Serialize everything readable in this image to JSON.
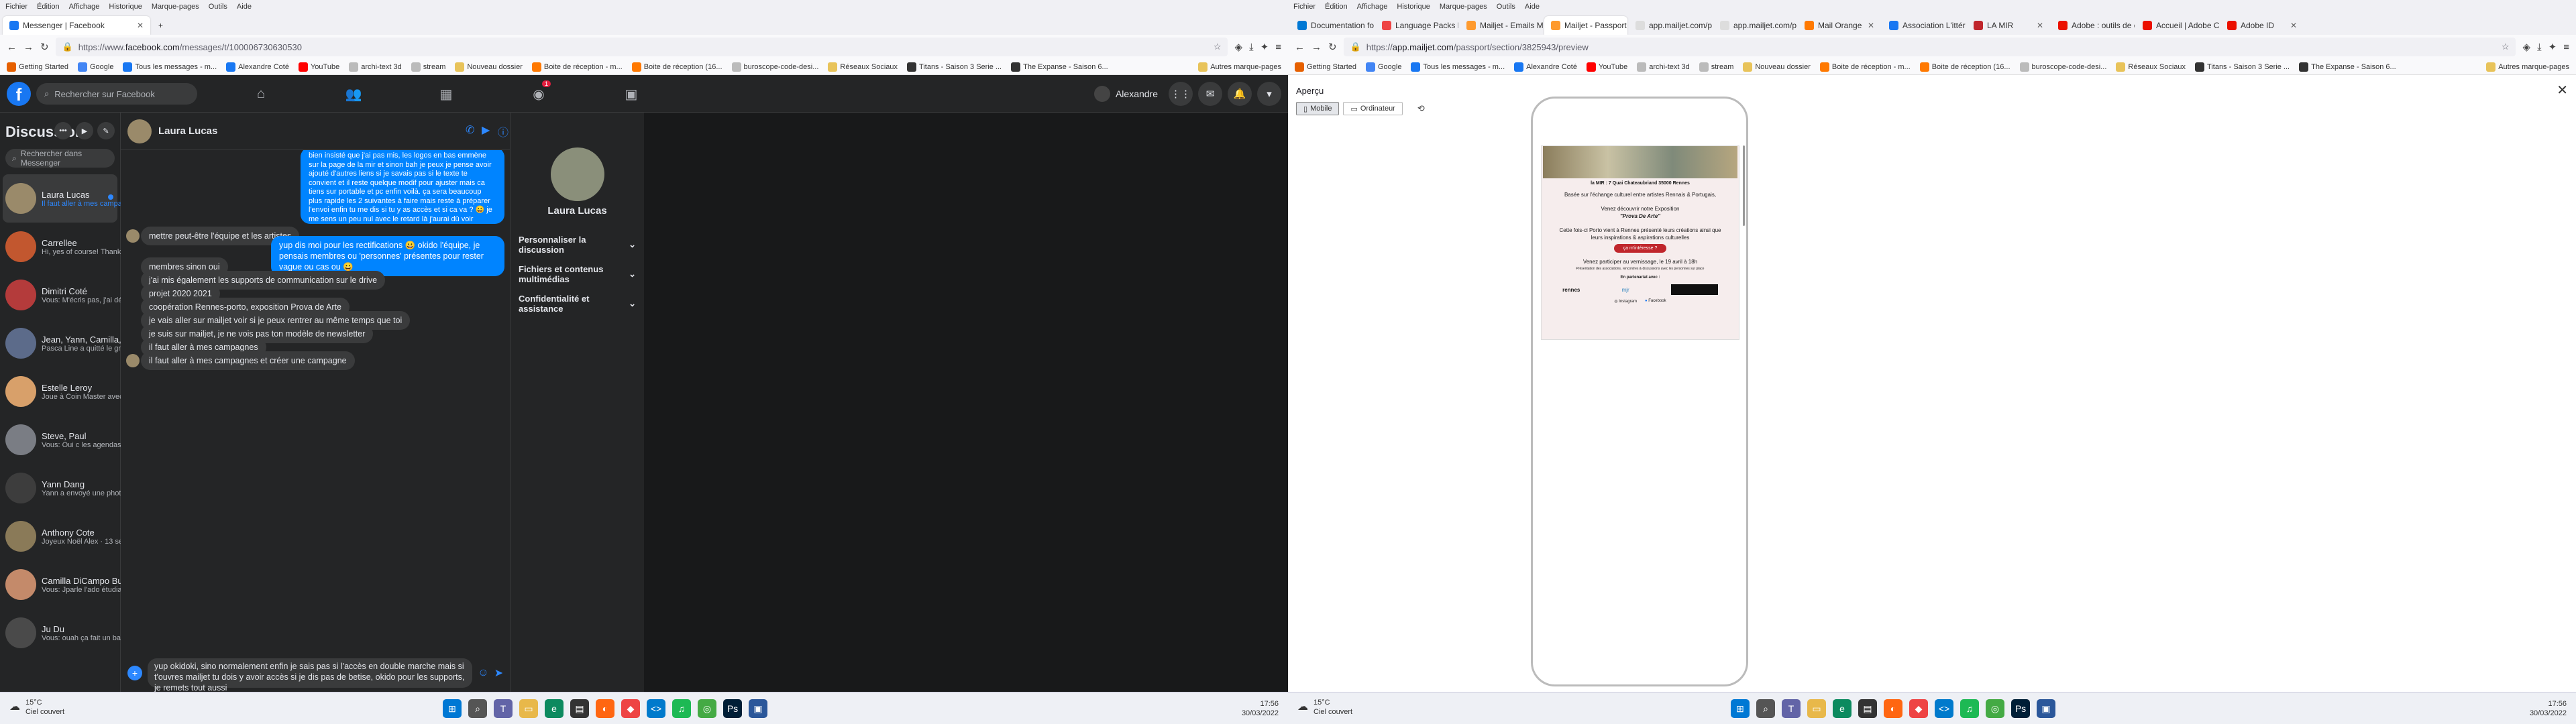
{
  "left": {
    "menu": [
      "Fichier",
      "Édition",
      "Affichage",
      "Historique",
      "Marque-pages",
      "Outils",
      "Aide"
    ],
    "tab": {
      "label": "Messenger | Facebook"
    },
    "url": {
      "prefix": "https://www.",
      "domain": "facebook.com",
      "path": "/messages/t/100006730630530"
    },
    "bookmarks": [
      "Getting Started",
      "Google",
      "Tous les messages - m...",
      "Alexandre Coté",
      "YouTube",
      "archi-text 3d",
      "stream",
      "Nouveau dossier",
      "Boite de réception - m...",
      "Boite de réception (16...",
      "buroscope-code-desi...",
      "Réseaux Sociaux",
      "Titans - Saison 3 Serie ...",
      "The Expanse - Saison 6...",
      "Autres marque-pages"
    ],
    "fb": {
      "search_placeholder": "Rechercher sur Facebook",
      "nav_badge": "1",
      "user": "Alexandre",
      "sidebar_title": "Discussions",
      "sidebar_search": "Rechercher dans Messenger",
      "conversations": [
        {
          "name": "Laura Lucas",
          "preview": "Il faut aller à mes campagnes ... · 1 min",
          "color": "#9a8a6a"
        },
        {
          "name": "Carrellee",
          "preview": "Hi, yes of course! Thanks for askin... · 6 min",
          "color": "#c2572f"
        },
        {
          "name": "Dimitri Coté",
          "preview": "Vous: M'écris pas, j'ai déjà blo... · 1 sem",
          "color": "#b43b3b"
        },
        {
          "name": "Jean, Yann, Camilla, Stephanie, M...",
          "preview": "Pasca Line a quitté le groupe. · 2 sem",
          "color": "#5c6b8a"
        },
        {
          "name": "Estelle Leroy",
          "preview": "Joue à Coin Master avec moi ! ... · 9 sem",
          "color": "#d8a06a"
        },
        {
          "name": "Steve, Paul",
          "preview": "Vous: Oui c les agendas qui... · 11 sem",
          "color": "#7a7d84"
        },
        {
          "name": "Yann Dang",
          "preview": "Yann a envoyé une photo. · 12 sem",
          "color": "#3d3d3d"
        },
        {
          "name": "Anthony Cote",
          "preview": "Joyeux Noël Alex · 13 sem",
          "color": "#8a7a58"
        },
        {
          "name": "Camilla DiCampo Bubonia",
          "preview": "Vous: Jparle l'ado étudiant fati... · 14 sem",
          "color": "#c48a6a"
        },
        {
          "name": "Ju Du",
          "preview": "Vous: ouah ça fait un bail ^^ ... · 16 sem",
          "color": "#4a4a4a"
        }
      ],
      "chat": {
        "name": "Laura Lucas",
        "me1": "bien insisté que j'ai pas mis, les logos en bas emmène sur la page de la mir et sinon bah je peux je pense avoir ajouté d'autres liens si je savais pas si le texte te convient et il reste quelque modif pour ajuster mais ca tiens sur portable et pc enfin voilà. ça sera beaucoup plus rapide les 2 suivantes à faire mais reste à préparer l'envoi enfin tu me dis si tu y as accès et si ca va ? 😀 je me sens un peu nul avec le retard là j'aurai dû voir mailjet dans le weekend, mais ça va en tout cas le maquettage de mail est assez simple, c'est juste l'envoi etc en mode groupé ou faudra me montrer ou m'expliquer au passage comment tu t'en sers, j'ai vu qu'on peut paramétrer pas mal de choses mais j'ai pas voulu trop plonger de peur de modifier un truc qui faut pas sur le compte enfin voilà 😀 ah oui le e à la fin ou ya là faute 😀 j'ai vu que tout à l'heure, mais c'est envoyable à peu près enfin toi qui voit si c'est pas trop 'bordélique' x) j'avoue que copier le code en 'html' tu verras que bon xp magique peut être mais à reprendre mouais xp",
        "them1": "mettre peut-être l'équipe et les artistes",
        "me2": "yup dis moi pour les rectifications 😀 okido l'équipe, je pensais membres ou 'personnes' présentes pour rester vague ou cas ou 😀",
        "them_list": [
          "membres sinon oui",
          "j'ai mis également les supports de communication sur le drive",
          "projet 2020 2021",
          "coopération Rennes-porto, exposition Prova de Arte",
          "je vais aller sur mailjet voir si je peux rentrer au même temps que toi",
          "je suis sur mailjet, je ne vois pas ton modèle de newsletter",
          "il faut aller à mes campagnes",
          "il faut aller à mes campagnes et créer une campagne"
        ],
        "composer": "yup okidoki, sino normalement enfin je sais pas si l'accès en double marche mais si t'ouvres mailjet tu dois y avoir accès si je dis pas de betise, okido pour les supports, je remets tout aussi"
      },
      "info": {
        "name": "Laura Lucas",
        "sections": [
          "Personnaliser la discussion",
          "Fichiers et contenus multimédias",
          "Confidentialité et assistance"
        ]
      }
    },
    "tray": {
      "temp": "15°C",
      "sky": "Ciel couvert",
      "time": "17:56",
      "date": "30/03/2022"
    }
  },
  "right": {
    "menu": [
      "Fichier",
      "Édition",
      "Affichage",
      "Historique",
      "Marque-pages",
      "Outils",
      "Aide"
    ],
    "tabs": [
      "Documentation fo",
      "Language Packs li",
      "Mailjet - Emails M",
      "Mailjet - Passport",
      "app.mailjet.com/pa",
      "app.mailjet.com/pa",
      "Mail Orange",
      "Association L'ittéra",
      "LA MIR",
      "Adobe : outils de c",
      "Accueil | Adobe Cr",
      "Adobe ID"
    ],
    "url": {
      "prefix": "https://",
      "domain": "app.mailjet.com",
      "path": "/passport/section/3825943/preview"
    },
    "bookmarks": [
      "Getting Started",
      "Google",
      "Tous les messages - m...",
      "Alexandre Coté",
      "YouTube",
      "archi-text 3d",
      "stream",
      "Nouveau dossier",
      "Boite de réception - m...",
      "Boite de réception (16...",
      "buroscope-code-desi...",
      "Réseaux Sociaux",
      "Titans - Saison 3 Serie ...",
      "The Expanse - Saison 6...",
      "Autres marque-pages"
    ],
    "mailjet": {
      "title": "Aperçu",
      "mobile": "Mobile",
      "desktop": "Ordinateur",
      "news": {
        "address": "la MIR : 7 Quai Chateaubriand 35000 Rennes",
        "p1": "Basée sur l'échange culturel entre artistes Rennais & Portugais,",
        "p2a": "Venez découvrir notre Exposition",
        "p2b": "\"Prova De Arte\"",
        "p3": "Cette fois-ci Porto vient à Rennes présenté leurs créations ainsi que leurs inspirations & aspirations culturelles",
        "cta": "ça m'intéresse ?",
        "p4": "Venez participer au vernissage, le 19 avril à 18h",
        "p5": "Présentation des associations, rencontres & discussions avec les personnes sur place",
        "partners": "En partenariat avec :",
        "logo1": "rennes",
        "logo2": "mjr",
        "social1": "Instagram",
        "social2": "Facebook"
      }
    },
    "tray": {
      "temp": "15°C",
      "sky": "Ciel couvert",
      "time": "17:56",
      "date": "30/03/2022"
    }
  }
}
